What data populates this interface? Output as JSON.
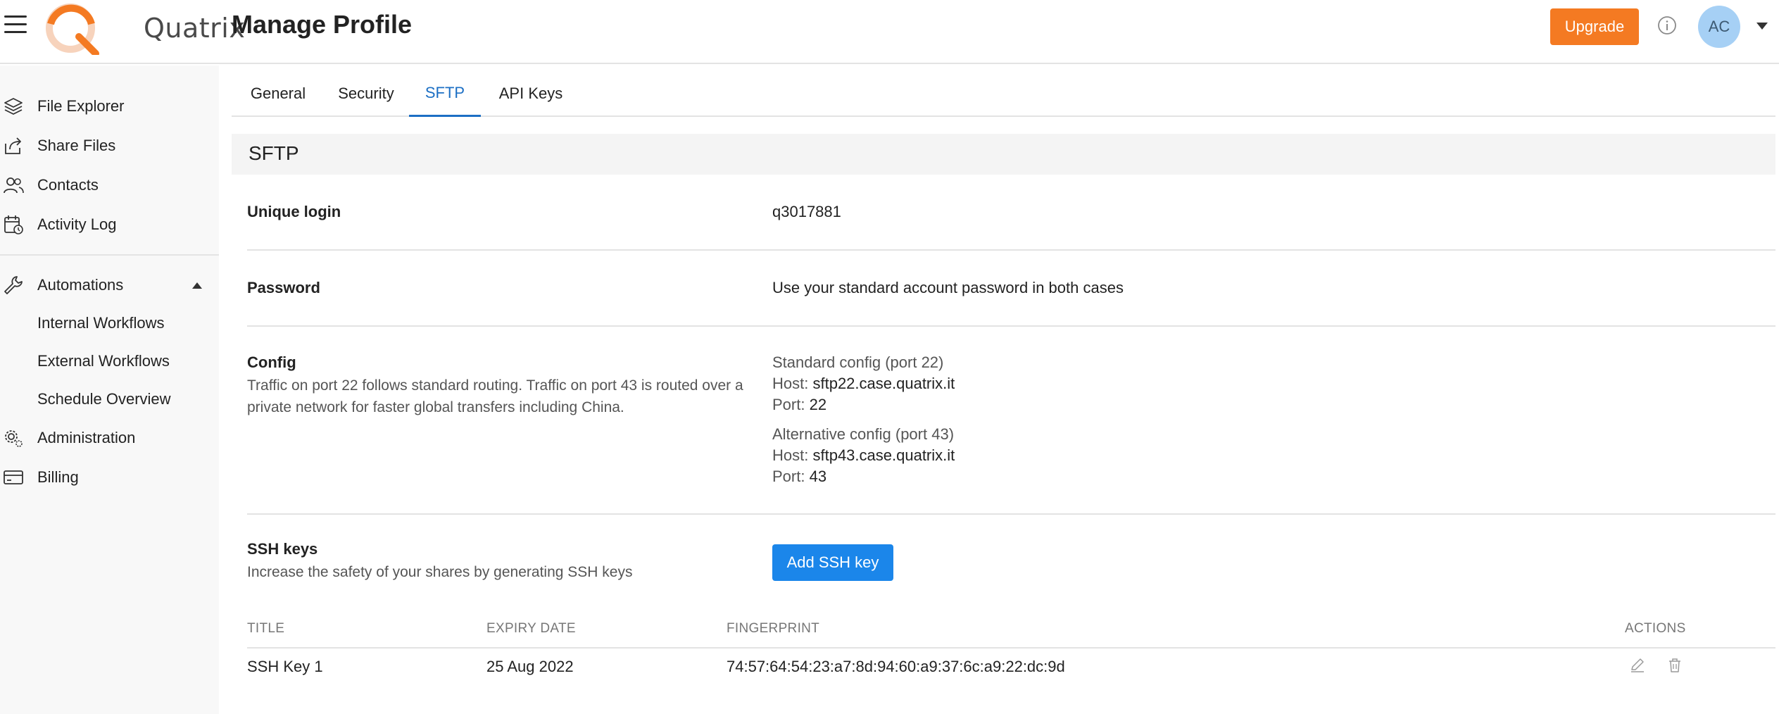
{
  "header": {
    "logo_text": "Quatrix",
    "page_title": "Manage Profile",
    "upgrade_label": "Upgrade",
    "avatar_initials": "AC",
    "accent_color": "#f47a22"
  },
  "sidebar": {
    "items": [
      {
        "label": "File Explorer",
        "icon": "layers-icon"
      },
      {
        "label": "Share Files",
        "icon": "share-icon"
      },
      {
        "label": "Contacts",
        "icon": "contacts-icon"
      },
      {
        "label": "Activity Log",
        "icon": "activity-log-icon"
      },
      {
        "label": "Automations",
        "icon": "wrench-icon"
      },
      {
        "label": "Administration",
        "icon": "gears-icon"
      },
      {
        "label": "Billing",
        "icon": "card-icon"
      }
    ],
    "automation_sub": [
      "Internal Workflows",
      "External Workflows",
      "Schedule Overview"
    ]
  },
  "tabs": [
    {
      "label": "General"
    },
    {
      "label": "Security"
    },
    {
      "label": "SFTP",
      "active": true
    },
    {
      "label": "API Keys"
    }
  ],
  "sftp": {
    "section_title": "SFTP",
    "unique_login": {
      "label": "Unique login",
      "value": "q3017881"
    },
    "password": {
      "label": "Password",
      "value": "Use your standard account password in both cases"
    },
    "config": {
      "label": "Config",
      "description": "Traffic on port 22 follows standard routing. Traffic on port 43 is routed over a private network for faster global transfers including China.",
      "standard": {
        "title": "Standard config (port 22)",
        "host_label": "Host:",
        "host": "sftp22.case.quatrix.it",
        "port_label": "Port:",
        "port": "22"
      },
      "alternative": {
        "title": "Alternative config (port 43)",
        "host_label": "Host:",
        "host": "sftp43.case.quatrix.it",
        "port_label": "Port:",
        "port": "43"
      }
    },
    "ssh": {
      "label": "SSH keys",
      "description": "Increase the safety of your shares by generating SSH keys",
      "add_button": "Add SSH key",
      "button_color": "#1b86ea",
      "columns": [
        "TITLE",
        "EXPIRY DATE",
        "FINGERPRINT",
        "ACTIONS"
      ],
      "rows": [
        {
          "title": "SSH Key 1",
          "expiry": "25 Aug 2022",
          "fingerprint": "74:57:64:54:23:a7:8d:94:60:a9:37:6c:a9:22:dc:9d"
        }
      ]
    }
  }
}
